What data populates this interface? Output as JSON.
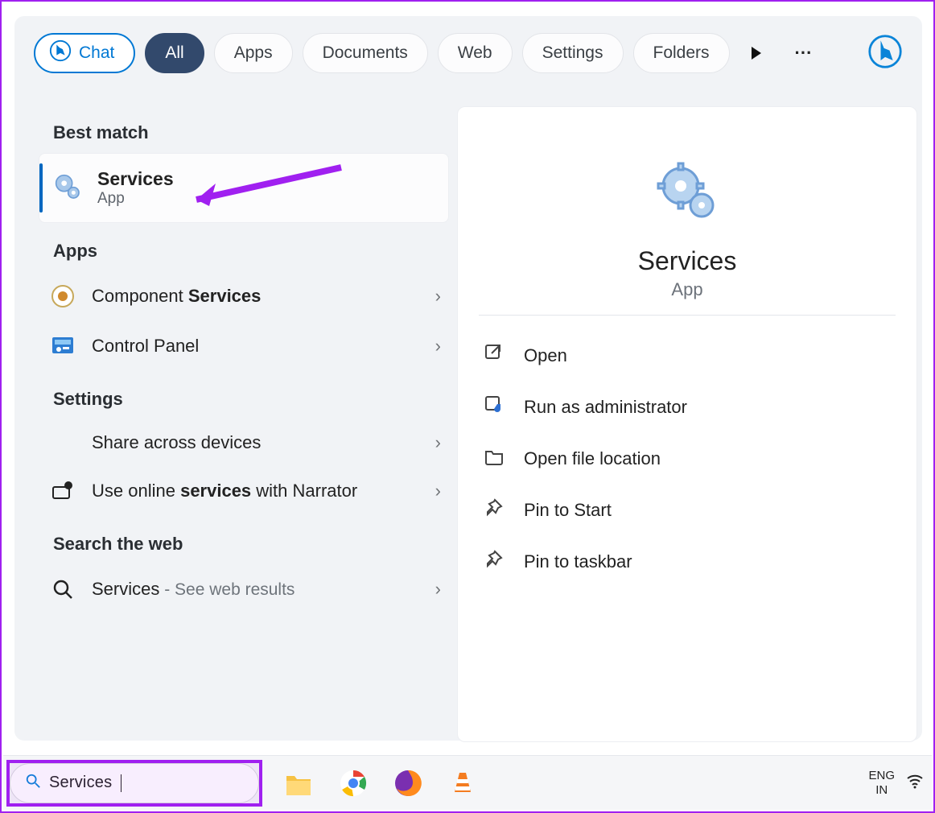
{
  "tabs": {
    "chat": "Chat",
    "all": "All",
    "apps": "Apps",
    "documents": "Documents",
    "web": "Web",
    "settings": "Settings",
    "folders": "Folders"
  },
  "groups": {
    "best_match": "Best match",
    "apps": "Apps",
    "settings": "Settings",
    "search_web": "Search the web"
  },
  "best_match": {
    "title": "Services",
    "subtitle": "App"
  },
  "apps_list": [
    {
      "prefix": "Component ",
      "match": "Services",
      "suffix": ""
    },
    {
      "prefix": "Control Panel",
      "match": "",
      "suffix": ""
    }
  ],
  "settings_list": [
    {
      "text": "Share across devices"
    },
    {
      "prefix": "Use online ",
      "match": "services",
      "suffix": " with Narrator"
    }
  ],
  "web_search": {
    "term": "Services",
    "suffix": " - See web results"
  },
  "detail": {
    "title": "Services",
    "subtitle": "App",
    "actions": {
      "open": "Open",
      "run_admin": "Run as administrator",
      "open_location": "Open file location",
      "pin_start": "Pin to Start",
      "pin_taskbar": "Pin to taskbar"
    }
  },
  "taskbar": {
    "search_value": "Services",
    "lang1": "ENG",
    "lang2": "IN"
  }
}
